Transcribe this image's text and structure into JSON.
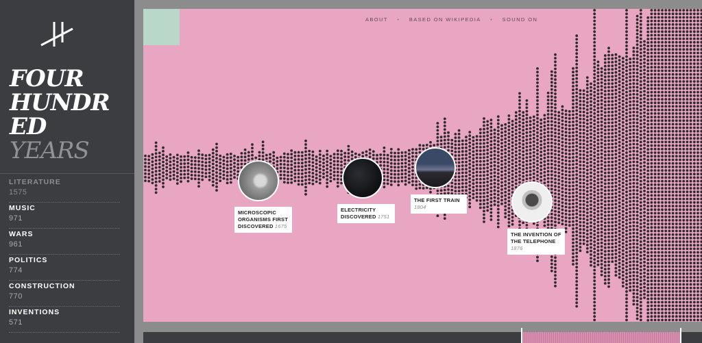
{
  "sidebar": {
    "title_lines": [
      "FOUR",
      "HUNDR",
      "ED",
      "YEARS"
    ],
    "categories": [
      {
        "name": "LITERATURE",
        "count": "1575"
      },
      {
        "name": "MUSIC",
        "count": "971"
      },
      {
        "name": "WARS",
        "count": "961"
      },
      {
        "name": "POLITICS",
        "count": "774"
      },
      {
        "name": "CONSTRUCTION",
        "count": "770"
      },
      {
        "name": "INVENTIONS",
        "count": "571"
      }
    ]
  },
  "nav": {
    "about": "ABOUT",
    "source": "BASED ON WIKIPEDIA",
    "sound": "SOUND ON"
  },
  "events": [
    {
      "title": "MICROSCOPIC ORGANISMS FIRST DISCOVERED",
      "year": "1675",
      "icon": "microscope-photo"
    },
    {
      "title": "ELECTRICITY DISCOVERED",
      "year": "1751",
      "icon": "dark-photo"
    },
    {
      "title": "THE FIRST TRAIN",
      "year": "1804",
      "icon": "bridge-photo"
    },
    {
      "title": "THE INVENTION OF THE TELEPHONE",
      "year": "1876",
      "icon": "telephone-photo"
    }
  ],
  "colors": {
    "sidebar": "#3b3d40",
    "canvas": "#e9a6c3",
    "dots": "#2e2a2d",
    "accent": "#b9d8c9"
  }
}
